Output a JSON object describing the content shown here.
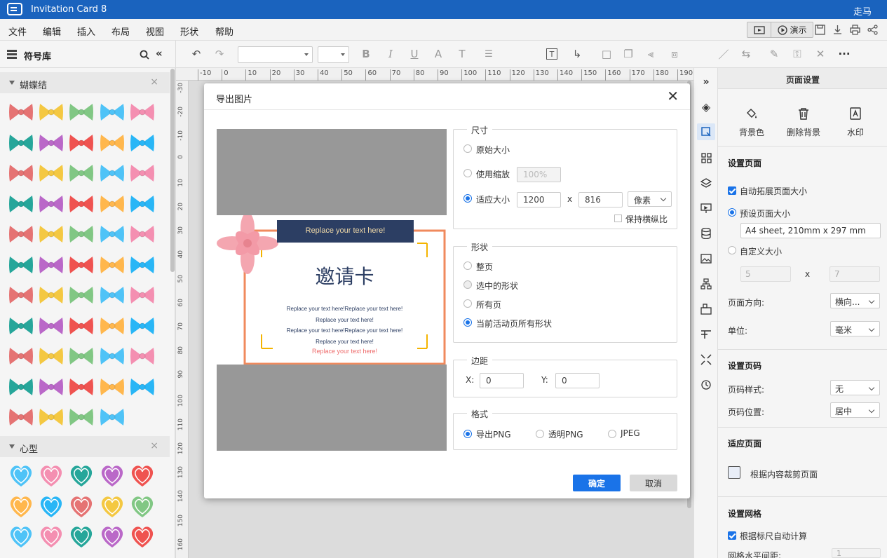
{
  "app": {
    "title": "Invitation Card 8",
    "user": "走马"
  },
  "menu": [
    "文件",
    "编辑",
    "插入",
    "布局",
    "视图",
    "形状",
    "帮助"
  ],
  "topbar": {
    "present_label": "演示"
  },
  "library": {
    "title": "符号库",
    "categories": [
      {
        "title": "蝴蝶结"
      },
      {
        "title": "心型"
      }
    ]
  },
  "ruler": {
    "h_ticks": [
      "-10",
      "0",
      "10",
      "20",
      "30",
      "40",
      "50",
      "60",
      "70",
      "80",
      "90",
      "100",
      "110",
      "120",
      "130",
      "140",
      "150",
      "160",
      "170",
      "180",
      "190"
    ],
    "v_ticks": [
      "-30",
      "-20",
      "-10",
      "0",
      "10",
      "20",
      "30",
      "40",
      "50",
      "60",
      "70",
      "80",
      "90",
      "100",
      "110",
      "120",
      "130",
      "140",
      "150",
      "160"
    ]
  },
  "right_panel": {
    "title": "页面设置",
    "bg_tools": [
      {
        "label": "背景色"
      },
      {
        "label": "删除背景"
      },
      {
        "label": "水印"
      }
    ],
    "page_setup": {
      "title": "设置页面",
      "auto_expand": "自动拓展页面大小",
      "preset_size": "预设页面大小",
      "preset_value": "A4 sheet, 210mm x 297 mm",
      "custom_size": "自定义大小",
      "custom_w": "5",
      "custom_h": "7",
      "x": "x",
      "orientation_label": "页面方向:",
      "orientation_value": "横向...",
      "unit_label": "单位:",
      "unit_value": "毫米"
    },
    "page_number": {
      "title": "设置页码",
      "style_label": "页码样式:",
      "style_value": "无",
      "position_label": "页码位置:",
      "position_value": "居中"
    },
    "fit_page": {
      "title": "适应页面",
      "crop_label": "根据内容裁剪页面"
    },
    "grid": {
      "title": "设置网格",
      "auto_calc": "根据标尺自动计算",
      "h_spacing": "网格水平间距:",
      "h_value": "1"
    }
  },
  "dialog": {
    "title": "导出图片",
    "size": {
      "legend": "尺寸",
      "original": "原始大小",
      "scale": "使用缩放",
      "scale_value": "100%",
      "fit": "适应大小",
      "width": "1200",
      "x": "x",
      "height": "816",
      "unit": "像素",
      "keep_ratio": "保持横纵比"
    },
    "shape": {
      "legend": "形状",
      "whole": "整页",
      "selected": "选中的形状",
      "all_pages": "所有页",
      "current": "当前活动页所有形状"
    },
    "margin": {
      "legend": "边距",
      "x_label": "X:",
      "x_value": "0",
      "y_label": "Y:",
      "y_value": "0"
    },
    "format": {
      "legend": "格式",
      "png": "导出PNG",
      "transparent_png": "透明PNG",
      "jpeg": "JPEG"
    },
    "ok": "确定",
    "cancel": "取消",
    "preview": {
      "banner": "Replace your text here!",
      "heading": "邀请卡",
      "lines": [
        "Replace your text here!Replace your text here!",
        "Replace your text here!",
        "Replace your text here!Replace your text here!",
        "Replace your text here!"
      ],
      "highlight": "Replace your text here!"
    }
  },
  "colors": {
    "titlebar": "#1a63be",
    "accent": "#1a73e8",
    "card_border": "#f08a5d",
    "card_banner": "#2c3e63",
    "card_corner": "#f4b400"
  }
}
